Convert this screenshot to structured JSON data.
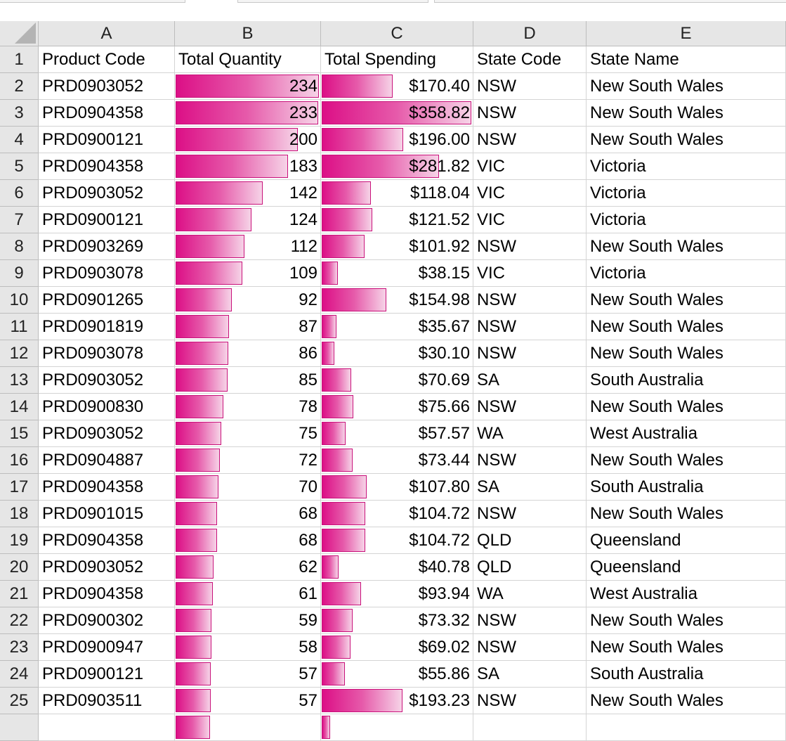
{
  "app": {
    "title": "Spreadsheet"
  },
  "columns": [
    "A",
    "B",
    "C",
    "D",
    "E"
  ],
  "accent_color": "#dc0f86",
  "headers": [
    "Product Code",
    "Total Quantity",
    "Total Spending",
    "State Code",
    "State Name"
  ],
  "databar_max": {
    "quantity": 234,
    "spending": 358.82
  },
  "rows": [
    {
      "n": "2",
      "code": "PRD0903052",
      "qty": 234,
      "spend": 170.4,
      "spend_text": "$170.40",
      "state_code": "NSW",
      "state_name": "New South Wales"
    },
    {
      "n": "3",
      "code": "PRD0904358",
      "qty": 233,
      "spend": 358.82,
      "spend_text": "$358.82",
      "state_code": "NSW",
      "state_name": "New South Wales"
    },
    {
      "n": "4",
      "code": "PRD0900121",
      "qty": 200,
      "spend": 196.0,
      "spend_text": "$196.00",
      "state_code": "NSW",
      "state_name": "New South Wales"
    },
    {
      "n": "5",
      "code": "PRD0904358",
      "qty": 183,
      "spend": 281.82,
      "spend_text": "$281.82",
      "state_code": "VIC",
      "state_name": "Victoria"
    },
    {
      "n": "6",
      "code": "PRD0903052",
      "qty": 142,
      "spend": 118.04,
      "spend_text": "$118.04",
      "state_code": "VIC",
      "state_name": "Victoria"
    },
    {
      "n": "7",
      "code": "PRD0900121",
      "qty": 124,
      "spend": 121.52,
      "spend_text": "$121.52",
      "state_code": "VIC",
      "state_name": "Victoria"
    },
    {
      "n": "8",
      "code": "PRD0903269",
      "qty": 112,
      "spend": 101.92,
      "spend_text": "$101.92",
      "state_code": "NSW",
      "state_name": "New South Wales"
    },
    {
      "n": "9",
      "code": "PRD0903078",
      "qty": 109,
      "spend": 38.15,
      "spend_text": "$38.15",
      "state_code": "VIC",
      "state_name": "Victoria"
    },
    {
      "n": "10",
      "code": "PRD0901265",
      "qty": 92,
      "spend": 154.98,
      "spend_text": "$154.98",
      "state_code": "NSW",
      "state_name": "New South Wales"
    },
    {
      "n": "11",
      "code": "PRD0901819",
      "qty": 87,
      "spend": 35.67,
      "spend_text": "$35.67",
      "state_code": "NSW",
      "state_name": "New South Wales"
    },
    {
      "n": "12",
      "code": "PRD0903078",
      "qty": 86,
      "spend": 30.1,
      "spend_text": "$30.10",
      "state_code": "NSW",
      "state_name": "New South Wales"
    },
    {
      "n": "13",
      "code": "PRD0903052",
      "qty": 85,
      "spend": 70.69,
      "spend_text": "$70.69",
      "state_code": "SA",
      "state_name": "South Australia"
    },
    {
      "n": "14",
      "code": "PRD0900830",
      "qty": 78,
      "spend": 75.66,
      "spend_text": "$75.66",
      "state_code": "NSW",
      "state_name": "New South Wales"
    },
    {
      "n": "15",
      "code": "PRD0903052",
      "qty": 75,
      "spend": 57.57,
      "spend_text": "$57.57",
      "state_code": "WA",
      "state_name": "West Australia"
    },
    {
      "n": "16",
      "code": "PRD0904887",
      "qty": 72,
      "spend": 73.44,
      "spend_text": "$73.44",
      "state_code": "NSW",
      "state_name": "New South Wales"
    },
    {
      "n": "17",
      "code": "PRD0904358",
      "qty": 70,
      "spend": 107.8,
      "spend_text": "$107.80",
      "state_code": "SA",
      "state_name": "South Australia"
    },
    {
      "n": "18",
      "code": "PRD0901015",
      "qty": 68,
      "spend": 104.72,
      "spend_text": "$104.72",
      "state_code": "NSW",
      "state_name": "New South Wales"
    },
    {
      "n": "19",
      "code": "PRD0904358",
      "qty": 68,
      "spend": 104.72,
      "spend_text": "$104.72",
      "state_code": "QLD",
      "state_name": "Queensland"
    },
    {
      "n": "20",
      "code": "PRD0903052",
      "qty": 62,
      "spend": 40.78,
      "spend_text": "$40.78",
      "state_code": "QLD",
      "state_name": "Queensland"
    },
    {
      "n": "21",
      "code": "PRD0904358",
      "qty": 61,
      "spend": 93.94,
      "spend_text": "$93.94",
      "state_code": "WA",
      "state_name": "West Australia"
    },
    {
      "n": "22",
      "code": "PRD0900302",
      "qty": 59,
      "spend": 73.32,
      "spend_text": "$73.32",
      "state_code": "NSW",
      "state_name": "New South Wales"
    },
    {
      "n": "23",
      "code": "PRD0900947",
      "qty": 58,
      "spend": 69.02,
      "spend_text": "$69.02",
      "state_code": "NSW",
      "state_name": "New South Wales"
    },
    {
      "n": "24",
      "code": "PRD0900121",
      "qty": 57,
      "spend": 55.86,
      "spend_text": "$55.86",
      "state_code": "SA",
      "state_name": "South Australia"
    },
    {
      "n": "25",
      "code": "PRD0903511",
      "qty": 57,
      "spend": 193.23,
      "spend_text": "$193.23",
      "state_code": "NSW",
      "state_name": "New South Wales"
    },
    {
      "n": "",
      "code": "",
      "qty": 56,
      "spend": 20,
      "spend_text": "",
      "state_code": "",
      "state_name": ""
    }
  ]
}
